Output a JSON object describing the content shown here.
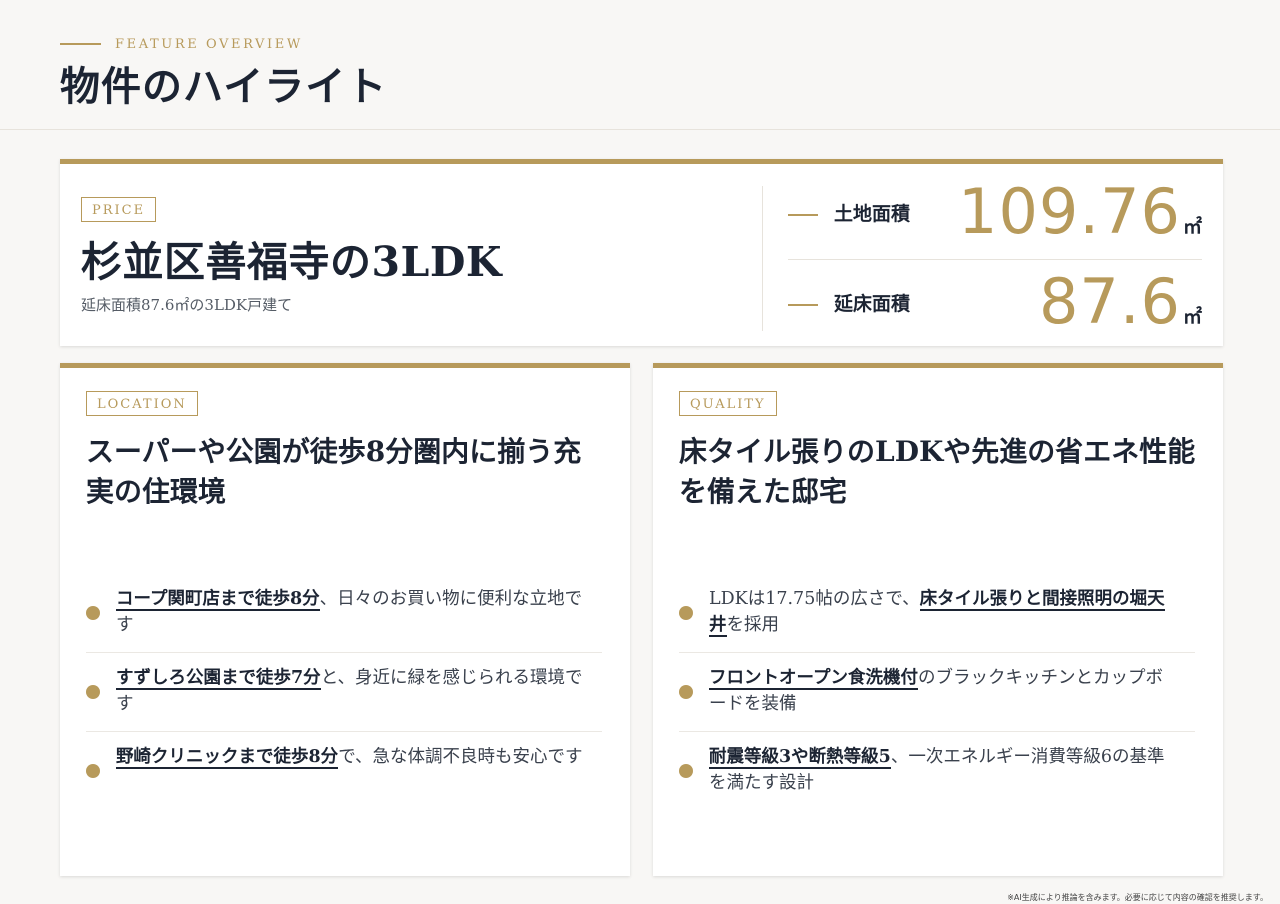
{
  "header": {
    "eyebrow": "FEATURE OVERVIEW",
    "title": "物件のハイライト"
  },
  "price_card": {
    "tag": "PRICE",
    "heading": "杉並区善福寺の3LDK",
    "subtitle": "延床面積87.6㎡の3LDK戸建て",
    "metrics": [
      {
        "label": "土地面積",
        "value": "109.76",
        "unit": "㎡"
      },
      {
        "label": "延床面積",
        "value": "87.6",
        "unit": "㎡"
      }
    ]
  },
  "location_card": {
    "tag": "LOCATION",
    "heading": "スーパーや公園が徒歩8分圏内に揃う充実の住環境",
    "items": [
      {
        "highlight": "コープ関町店まで徒歩8分",
        "rest": "、日々のお買い物に便利な立地です"
      },
      {
        "highlight": "すずしろ公園まで徒歩7分",
        "rest": "と、身近に緑を感じられる環境です"
      },
      {
        "highlight": "野崎クリニックまで徒歩8分",
        "rest": "で、急な体調不良時も安心です"
      }
    ]
  },
  "quality_card": {
    "tag": "QUALITY",
    "heading": "床タイル張りのLDKや先進の省エネ性能を備えた邸宅",
    "items": [
      {
        "pre": "LDKは17.75帖の広さで、",
        "highlight": "床タイル張りと間接照明の堀天井",
        "rest": "を採用"
      },
      {
        "pre": "",
        "highlight": "フロントオープン食洗機付",
        "rest": "のブラックキッチンとカップボードを装備"
      },
      {
        "pre": "",
        "highlight": "耐震等級3や断熱等級5",
        "rest": "、一次エネルギー消費等級6の基準を満たす設計"
      }
    ]
  },
  "footnote": "※AI生成により推論を含みます。必要に応じて内容の確認を推奨します。",
  "colors": {
    "accent": "#b79a5b",
    "text": "#1c2433",
    "background": "#f8f7f5"
  }
}
